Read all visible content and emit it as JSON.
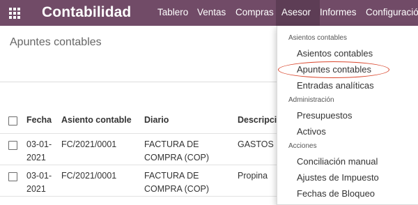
{
  "app": {
    "name": "Contabilidad",
    "nav": [
      "Tablero",
      "Ventas",
      "Compras",
      "Asesor",
      "Informes",
      "Configuración"
    ],
    "active_nav": "Asesor"
  },
  "breadcrumb": "Apuntes contables",
  "table": {
    "headers": [
      "Fecha",
      "Asiento contable",
      "Diario",
      "Descripción"
    ],
    "rows": [
      {
        "fecha": "03-01-2021",
        "asiento": "FC/2021/0001",
        "diario": "FACTURA DE COMPRA (COP)",
        "descripcion": "GASTOS D"
      },
      {
        "fecha": "03-01-2021",
        "asiento": "FC/2021/0001",
        "diario": "FACTURA DE COMPRA (COP)",
        "descripcion": "Propina"
      }
    ]
  },
  "dropdown": {
    "sections": [
      {
        "title": "Asientos contables",
        "items": [
          "Asientos contables",
          "Apuntes contables",
          "Entradas analíticas"
        ]
      },
      {
        "title": "Administración",
        "items": [
          "Presupuestos",
          "Activos"
        ]
      },
      {
        "title": "Acciones",
        "items": [
          "Conciliación manual",
          "Ajustes de Impuesto",
          "Fechas de Bloqueo"
        ]
      }
    ],
    "highlighted_item": "Apuntes contables"
  },
  "colors": {
    "navbar": "#714b67",
    "active_nav": "#5d3d55",
    "annotation": "#d9452b"
  }
}
